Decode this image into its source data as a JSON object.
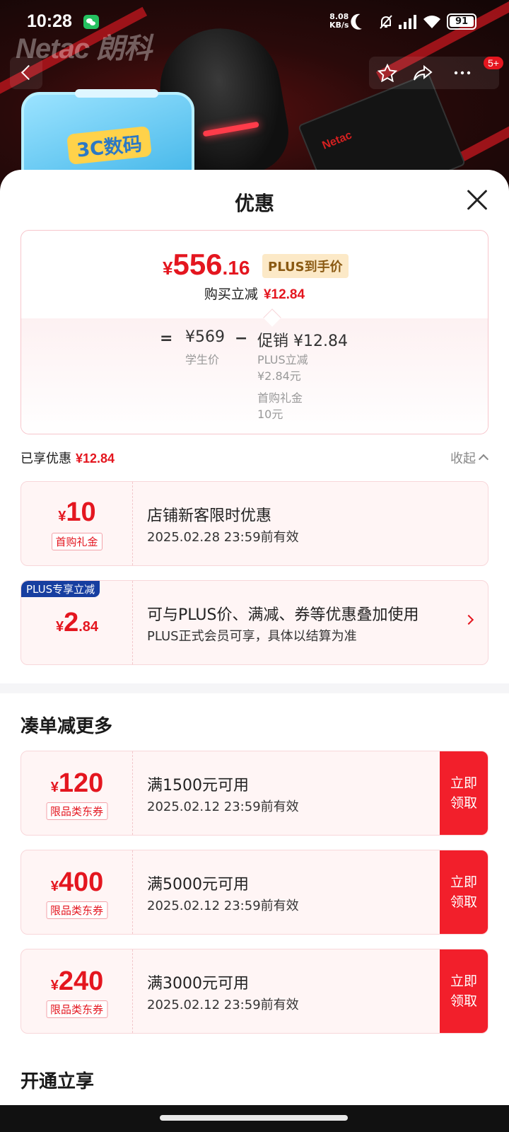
{
  "status_bar": {
    "time": "10:28",
    "net_speed_value": "8.08",
    "net_speed_unit": "KB/s",
    "battery": "91"
  },
  "hero": {
    "brand": "Netac 朗科",
    "sticker_text": "3C数码",
    "product_label": "Netac",
    "notification_badge": "5+"
  },
  "sheet": {
    "title": "优惠",
    "price": {
      "currency": "¥",
      "integer": "556",
      "decimal": ".16",
      "tag": "PLUS到手价",
      "instant_label": "购买立减",
      "instant_value": "¥12.84",
      "eq": "=",
      "base_value": "¥569",
      "base_label": "学生价",
      "minus": "−",
      "promo_label": "促销",
      "promo_value": "¥12.84",
      "plus_cut_label": "PLUS立减",
      "plus_cut_value": "¥2.84元",
      "gift_label": "首购礼金",
      "gift_value": "10元"
    },
    "enjoyed": {
      "label": "已享优惠",
      "value": "¥12.84",
      "collapse": "收起"
    },
    "enjoyed_coupons": [
      {
        "currency": "¥",
        "amount": "10",
        "decimal": "",
        "kind": "首购礼金",
        "title": "店铺新客限时优惠",
        "sub": "2025.02.28 23:59前有效"
      },
      {
        "corner": "PLUS专享立减",
        "currency": "¥",
        "amount": "2",
        "decimal": ".84",
        "title": "可与PLUS价、满减、券等优惠叠加使用",
        "sub": "PLUS正式会员可享，具体以结算为准"
      }
    ],
    "more_title": "凑单减更多",
    "more_coupons": [
      {
        "currency": "¥",
        "amount": "120",
        "kind": "限品类东券",
        "title": "满1500元可用",
        "sub": "2025.02.12 23:59前有效",
        "button": "立即领取"
      },
      {
        "currency": "¥",
        "amount": "400",
        "kind": "限品类东券",
        "title": "满5000元可用",
        "sub": "2025.02.12 23:59前有效",
        "button": "立即领取"
      },
      {
        "currency": "¥",
        "amount": "240",
        "kind": "限品类东券",
        "title": "满3000元可用",
        "sub": "2025.02.12 23:59前有效",
        "button": "立即领取"
      }
    ],
    "open_title": "开通立享"
  }
}
